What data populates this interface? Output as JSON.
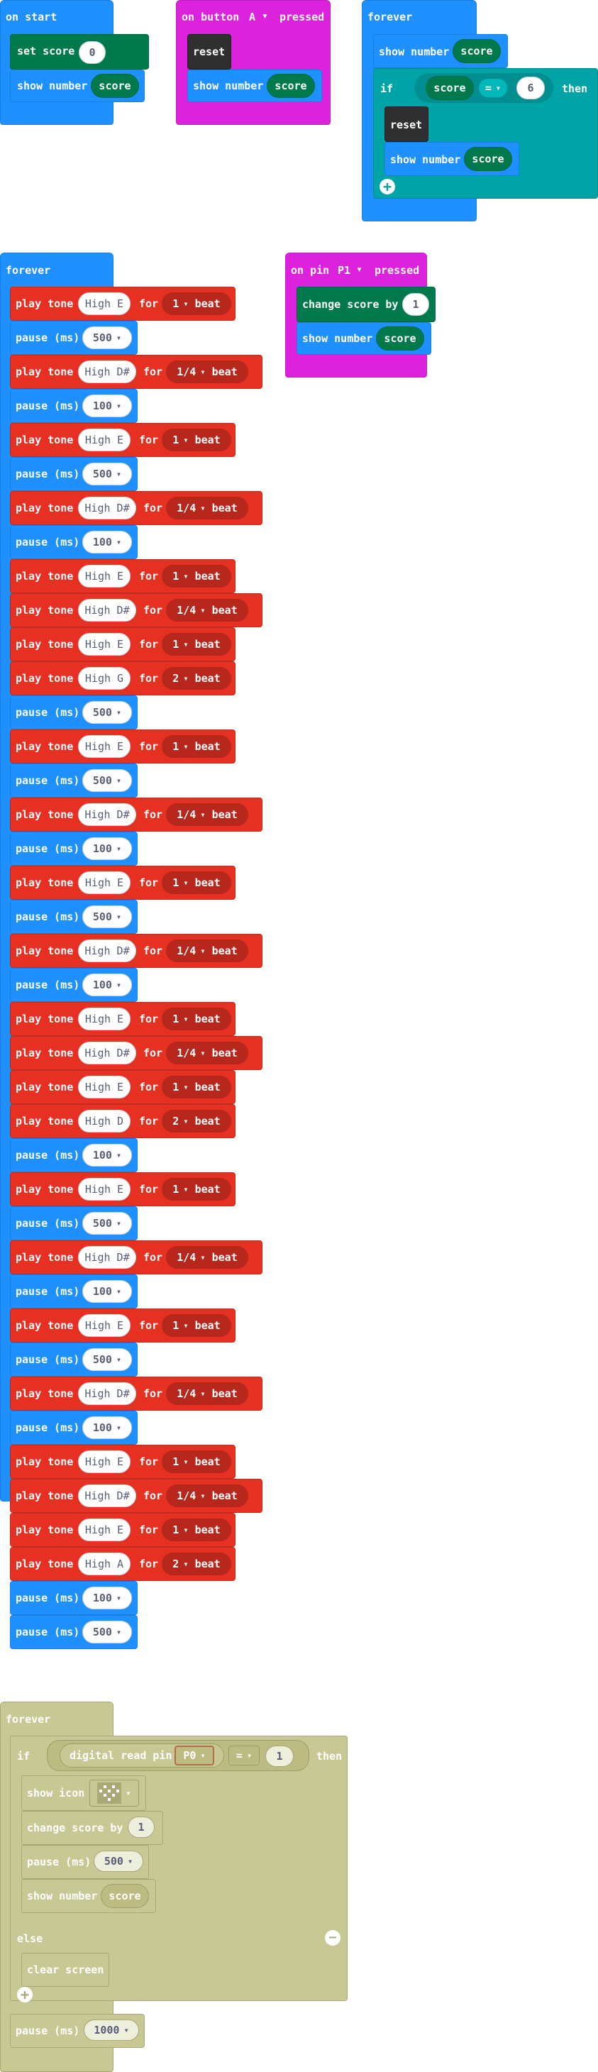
{
  "colors": {
    "events": "#1e90ff",
    "variables": "#007a4c",
    "input": "#dc22dc",
    "logic": "#00a4a6",
    "game": "#2f2f2f",
    "music": "#e63022",
    "disabled": "#c8c894"
  },
  "labels": {
    "on_start": "on start",
    "set_score": "set score",
    "to_value": "0",
    "show_number": "show number",
    "score": "score",
    "on_button": "on button",
    "button_a": "A",
    "pressed": "pressed",
    "reset": "reset",
    "forever": "forever",
    "if": "if",
    "eq": "=",
    "six": "6",
    "then": "then",
    "else": "else",
    "play_tone": "play tone",
    "for": "for",
    "beat": "beat",
    "pause_ms": "pause (ms)",
    "on_pin": "on pin",
    "pin": "P1",
    "change_score_by": "change score by",
    "one": "1",
    "digital_read_pin": "digital read pin",
    "pin_p0": "P0",
    "show_icon": "show icon",
    "clear_screen": "clear screen",
    "pause_1000": "1000",
    "pause_500": "500",
    "caret": "▾"
  },
  "melody": [
    {
      "kind": "tone",
      "note": "High E",
      "beats": "1"
    },
    {
      "kind": "pause",
      "ms": "500"
    },
    {
      "kind": "tone",
      "note": "High D#",
      "beats": "1/4"
    },
    {
      "kind": "pause",
      "ms": "100"
    },
    {
      "kind": "tone",
      "note": "High E",
      "beats": "1"
    },
    {
      "kind": "pause",
      "ms": "500"
    },
    {
      "kind": "tone",
      "note": "High D#",
      "beats": "1/4"
    },
    {
      "kind": "pause",
      "ms": "100"
    },
    {
      "kind": "tone",
      "note": "High E",
      "beats": "1"
    },
    {
      "kind": "tone",
      "note": "High D#",
      "beats": "1/4"
    },
    {
      "kind": "tone",
      "note": "High E",
      "beats": "1"
    },
    {
      "kind": "tone",
      "note": "High G",
      "beats": "2"
    },
    {
      "kind": "pause",
      "ms": "500"
    },
    {
      "kind": "tone",
      "note": "High E",
      "beats": "1"
    },
    {
      "kind": "pause",
      "ms": "500"
    },
    {
      "kind": "tone",
      "note": "High D#",
      "beats": "1/4"
    },
    {
      "kind": "pause",
      "ms": "100"
    },
    {
      "kind": "tone",
      "note": "High E",
      "beats": "1"
    },
    {
      "kind": "pause",
      "ms": "500"
    },
    {
      "kind": "tone",
      "note": "High D#",
      "beats": "1/4"
    },
    {
      "kind": "pause",
      "ms": "100"
    },
    {
      "kind": "tone",
      "note": "High E",
      "beats": "1"
    },
    {
      "kind": "tone",
      "note": "High D#",
      "beats": "1/4"
    },
    {
      "kind": "tone",
      "note": "High E",
      "beats": "1"
    },
    {
      "kind": "tone",
      "note": "High D",
      "beats": "2"
    },
    {
      "kind": "pause",
      "ms": "100"
    },
    {
      "kind": "tone",
      "note": "High E",
      "beats": "1"
    },
    {
      "kind": "pause",
      "ms": "500"
    },
    {
      "kind": "tone",
      "note": "High D#",
      "beats": "1/4"
    },
    {
      "kind": "pause",
      "ms": "100"
    },
    {
      "kind": "tone",
      "note": "High E",
      "beats": "1"
    },
    {
      "kind": "pause",
      "ms": "500"
    },
    {
      "kind": "tone",
      "note": "High D#",
      "beats": "1/4"
    },
    {
      "kind": "pause",
      "ms": "100"
    },
    {
      "kind": "tone",
      "note": "High E",
      "beats": "1"
    },
    {
      "kind": "tone",
      "note": "High D#",
      "beats": "1/4"
    },
    {
      "kind": "tone",
      "note": "High E",
      "beats": "1"
    },
    {
      "kind": "tone",
      "note": "High A",
      "beats": "2"
    },
    {
      "kind": "pause",
      "ms": "100"
    },
    {
      "kind": "pause",
      "ms": "500"
    }
  ]
}
